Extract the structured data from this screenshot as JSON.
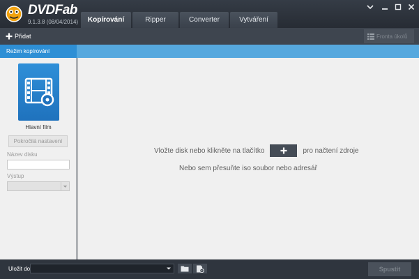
{
  "app": {
    "logo_text": "DVDFab",
    "version": "9.1.3.8 (08/04/2014)"
  },
  "tabs": [
    {
      "label": "Kopírování",
      "active": true
    },
    {
      "label": "Ripper",
      "active": false
    },
    {
      "label": "Converter",
      "active": false
    },
    {
      "label": "Vytváření",
      "active": false
    }
  ],
  "window_controls": [
    "menu-icon",
    "minimize-icon",
    "maximize-icon",
    "close-icon"
  ],
  "toolbar": {
    "add_label": "Přidat",
    "queue_label": "Fronta úkolů"
  },
  "mode": {
    "label": "Režim kopírování"
  },
  "sidebar": {
    "film_label": "Hlavní film",
    "advanced_label": "Pokročilá nastavení",
    "disc_name_label": "Název disku",
    "disc_name_value": "",
    "output_label": "Výstup",
    "output_value": ""
  },
  "main": {
    "prompt_before": "Vložte disk nebo klikněte na tlačítko",
    "prompt_after": "pro načtení zdroje",
    "drag_hint": "Nebo sem přesuňte iso soubor nebo adresář"
  },
  "bottom": {
    "save_label": "Uložit do:",
    "save_value": "",
    "start_label": "Spustit"
  },
  "colors": {
    "accent": "#2e8fd5",
    "accent_light": "#56a8de",
    "titlebar": "#2b313a",
    "panel": "#f0f0f0"
  }
}
